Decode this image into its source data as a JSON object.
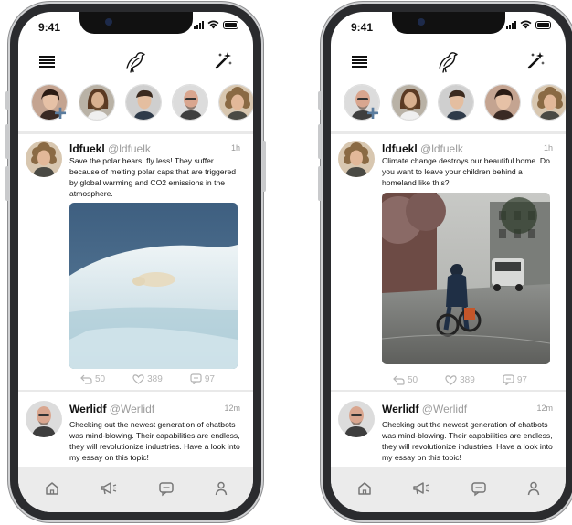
{
  "phones": [
    {
      "status": {
        "time": "9:41"
      },
      "tweets": [
        {
          "name": "ldfuekl",
          "handle": "@ldfuelk",
          "time": "1h",
          "text": "Save the polar bears, fly less! They suffer because of melting polar caps that are triggered by global warming and CO2 emissions in the atmosphere.",
          "image": "polar-bear-on-ice-photo",
          "stats": {
            "replies": "50",
            "likes": "389",
            "comments": "97"
          }
        },
        {
          "name": "Werlidf",
          "handle": "@Werlidf",
          "time": "12m",
          "text": "Checking out the newest generation of chatbots was mind-blowing. Their capabilities are endless, they will revolutionize industries. Have a look into my essay on this topic!"
        }
      ]
    },
    {
      "status": {
        "time": "9:41"
      },
      "tweets": [
        {
          "name": "ldfuekl",
          "handle": "@ldfuelk",
          "time": "1h",
          "text": "Climate change destroys our beautiful home. Do you want to leave your children behind a homeland like this?",
          "image": "flooded-street-cyclist-photo",
          "stats": {
            "replies": "50",
            "likes": "389",
            "comments": "97"
          }
        },
        {
          "name": "Werlidf",
          "handle": "@Werlidf",
          "time": "12m",
          "text": "Checking out the newest generation of chatbots was mind-blowing. Their capabilities are endless, they will revolutionize industries. Have a look into my essay on this topic!"
        }
      ]
    }
  ],
  "colors": {
    "accent": "#5a7c9e",
    "muted": "#9b9b9b",
    "nav_bg": "#ebebeb"
  },
  "icons": [
    "menu-icon",
    "bird-logo-icon",
    "magic-wand-icon",
    "add-story-icon",
    "retweet-icon",
    "heart-icon",
    "comment-icon",
    "home-icon",
    "megaphone-icon",
    "chat-icon",
    "profile-icon"
  ]
}
